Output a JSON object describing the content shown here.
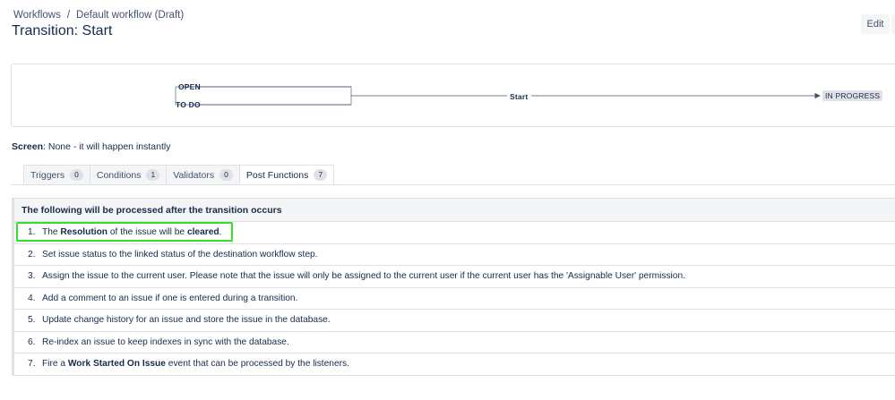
{
  "breadcrumb": {
    "items": [
      "Workflows",
      "Default workflow (Draft)"
    ],
    "separator": "/"
  },
  "page_title": "Transition: Start",
  "toolbar": {
    "edit_label": "Edit"
  },
  "diagram": {
    "from_statuses": [
      "OPEN",
      "TO DO"
    ],
    "transition_name": "Start",
    "to_status": "IN PROGRESS"
  },
  "screen": {
    "label": "Screen",
    "value": ": None - it will happen instantly"
  },
  "tabs": [
    {
      "label": "Triggers",
      "count": "0"
    },
    {
      "label": "Conditions",
      "count": "1"
    },
    {
      "label": "Validators",
      "count": "0"
    },
    {
      "label": "Post Functions",
      "count": "7",
      "active": true
    }
  ],
  "post_functions": {
    "header": "The following will be processed after the transition occurs",
    "items": [
      {
        "num": "1.",
        "pre": "The ",
        "b1": "Resolution",
        "mid": " of the issue will be ",
        "b2": "cleared",
        "post": "."
      },
      {
        "num": "2.",
        "text": "Set issue status to the linked status of the destination workflow step."
      },
      {
        "num": "3.",
        "text": "Assign the issue to the current user. Please note that the issue will only be assigned to the current user if the current user has the 'Assignable User' permission."
      },
      {
        "num": "4.",
        "text": "Add a comment to an issue if one is entered during a transition."
      },
      {
        "num": "5.",
        "text": "Update change history for an issue and store the issue in the database."
      },
      {
        "num": "6.",
        "text": "Re-index an issue to keep indexes in sync with the database."
      },
      {
        "num": "7.",
        "pre": "Fire a ",
        "b1": "Work Started On Issue",
        "post": " event that can be processed by the listeners."
      }
    ]
  },
  "colors": {
    "highlight": "#32e02c",
    "border": "#dfe1e6",
    "text": "#172b4d"
  }
}
